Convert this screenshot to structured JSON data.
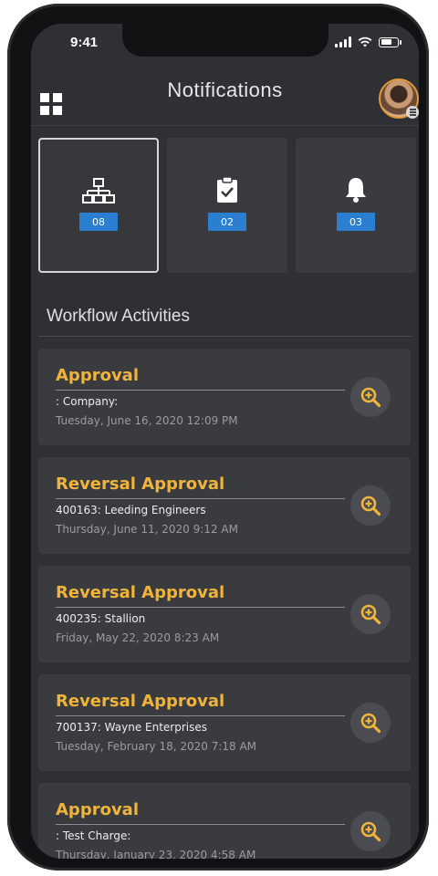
{
  "status_bar": {
    "time": "9:41"
  },
  "header": {
    "title": "Notifications",
    "menu_icon": "grid-icon",
    "avatar_icon": "user-avatar"
  },
  "tiles": [
    {
      "icon": "network-icon",
      "count": "08",
      "active": true
    },
    {
      "icon": "clipboard-check-icon",
      "count": "02",
      "active": false
    },
    {
      "icon": "bell-icon",
      "count": "03",
      "active": false
    }
  ],
  "section": {
    "title": "Workflow Activities"
  },
  "activities": [
    {
      "title": "Approval",
      "subtitle": ": Company:",
      "date": "Tuesday, June 16, 2020 12:09 PM"
    },
    {
      "title": "Reversal Approval",
      "subtitle": "400163: Leeding Engineers",
      "date": "Thursday, June 11, 2020 9:12 AM"
    },
    {
      "title": "Reversal Approval",
      "subtitle": "400235: Stallion",
      "date": "Friday, May 22, 2020 8:23 AM"
    },
    {
      "title": "Reversal Approval",
      "subtitle": "700137: Wayne Enterprises",
      "date": "Tuesday, February 18, 2020 7:18 AM"
    },
    {
      "title": "Approval",
      "subtitle": ": Test Charge:",
      "date": "Thursday, January 23, 2020 4:58 AM"
    }
  ],
  "colors": {
    "accent": "#f0b43a",
    "badge": "#2b7fd0",
    "background": "#2e3034",
    "card": "#393b3f"
  }
}
